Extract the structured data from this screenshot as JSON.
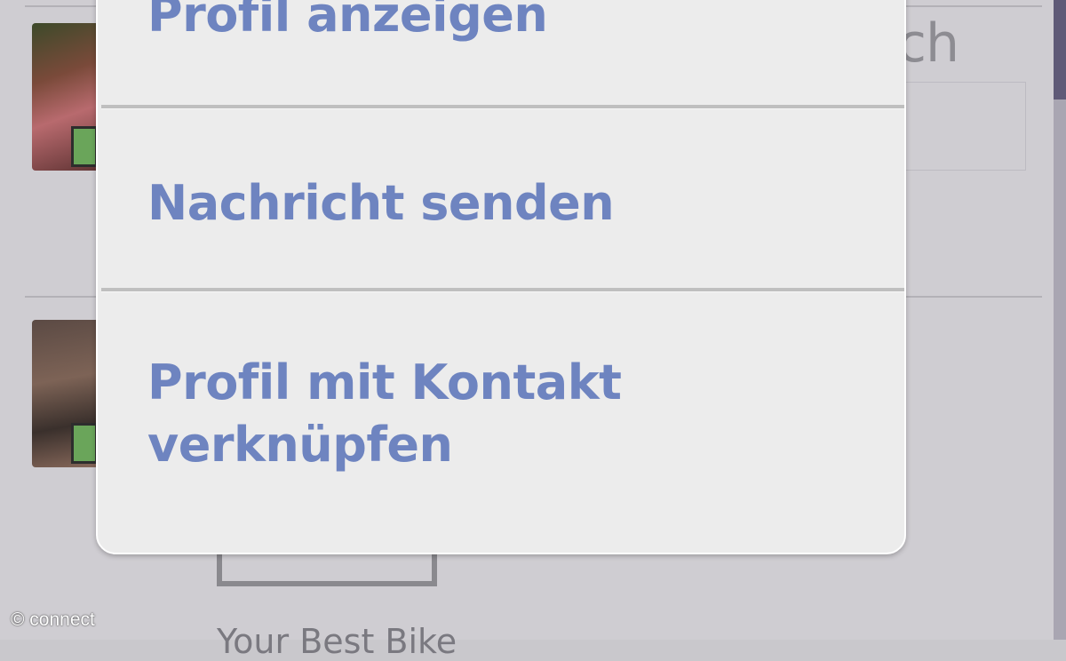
{
  "popup_menu": {
    "items": [
      {
        "label": "Profil anzeigen"
      },
      {
        "label": "Nachricht senden"
      },
      {
        "label": "Profil mit Kontakt verknüpfen"
      }
    ],
    "text_color": "#6e84c0",
    "background_color": "#ececec"
  },
  "background": {
    "partial_search_label": "ch",
    "partial_caption": "Your Best Bike"
  },
  "watermark": {
    "text": "© connect"
  }
}
